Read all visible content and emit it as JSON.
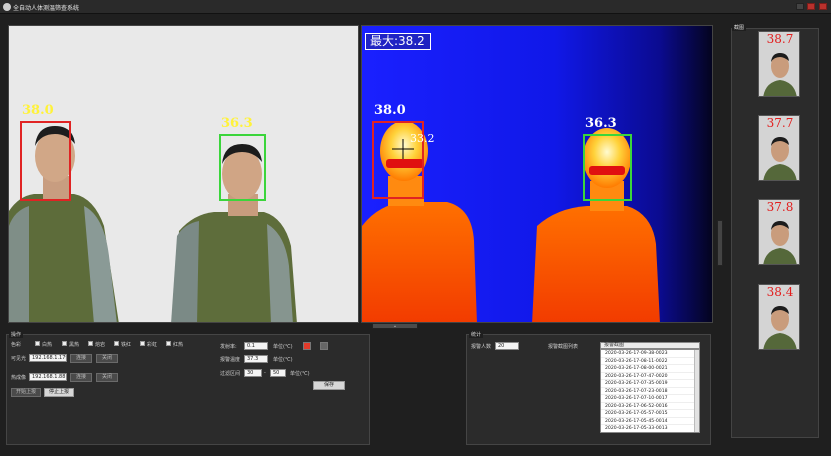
{
  "window": {
    "title": "全自动人体测温筛查系统"
  },
  "rgb_view": {
    "faces": [
      {
        "temp": "38.0",
        "status": "alert"
      },
      {
        "temp": "36.3",
        "status": "normal"
      }
    ]
  },
  "thermal_view": {
    "max_temp_label": "最大:38.2",
    "cursor_temp": "33.2",
    "faces": [
      {
        "temp": "38.0",
        "status": "alert"
      },
      {
        "temp": "36.3",
        "status": "normal"
      }
    ]
  },
  "sidebar": {
    "legend": "截图",
    "snapshots": [
      "38.7",
      "37.7",
      "37.8",
      "38.4"
    ]
  },
  "ops": {
    "legend": "操作",
    "color_label": "色彩",
    "palettes": [
      "白热",
      "黑热",
      "熔岩",
      "铁红",
      "彩虹",
      "红热"
    ],
    "visible_label": "可见光",
    "visible_ip": "192.168.1.179",
    "thermal_label": "热成像",
    "thermal_ip": "192.168.1.88",
    "connect_btn": "连接",
    "close_btn": "关闭",
    "start_btn": "开始上报",
    "stop_btn": "停止上报",
    "emissivity_label": "发射率:",
    "emissivity_value": "0.1",
    "emissivity_unit": "单位(℃)",
    "alarm_label": "报警温度",
    "alarm_value": "37.3",
    "alarm_unit": "单位(℃)",
    "range_label": "过滤区间",
    "range_min": "30",
    "range_sep": "-",
    "range_max": "50",
    "range_unit": "单位(℃)",
    "save_btn": "保存"
  },
  "stats": {
    "legend": "统计",
    "alarm_count_label": "报警人数",
    "alarm_count": "20",
    "list_label": "报警截图列表",
    "list_header": "报警截图",
    "entries": [
      "2020-03-26-17-09-38-0023",
      "2020-03-26-17-08-11-0022",
      "2020-03-26-17-08-00-0021",
      "2020-03-26-17-07-47-0020",
      "2020-03-26-17-07-35-0019",
      "2020-03-26-17-07-23-0018",
      "2020-03-26-17-07-10-0017",
      "2020-03-26-17-06-52-0016",
      "2020-03-26-17-05-57-0015",
      "2020-03-26-17-05-45-0014",
      "2020-03-26-17-05-33-0013"
    ]
  }
}
